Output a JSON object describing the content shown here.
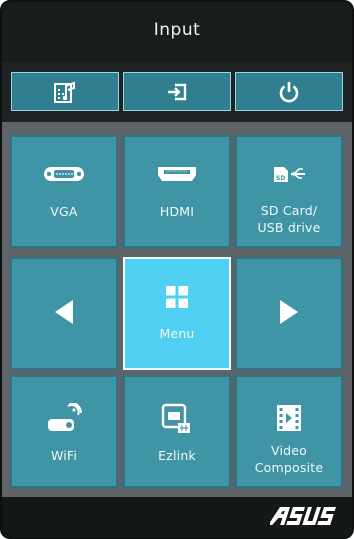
{
  "header": {
    "title": "Input"
  },
  "toolbar": {
    "buttons": [
      {
        "icon": "music-note-settings-icon"
      },
      {
        "icon": "input-source-icon"
      },
      {
        "icon": "power-icon"
      }
    ]
  },
  "tiles": {
    "vga": {
      "label": "VGA",
      "icon": "vga-port-icon"
    },
    "hdmi": {
      "label": "HDMI",
      "icon": "hdmi-port-icon"
    },
    "sd": {
      "label": "SD Card/\nUSB drive",
      "icon": "sd-usb-icon"
    },
    "left": {
      "icon": "left-arrow-icon"
    },
    "menu": {
      "label": "Menu",
      "icon": "menu-grid-icon"
    },
    "right": {
      "icon": "right-arrow-icon"
    },
    "wifi": {
      "label": "WiFi",
      "icon": "wifi-projector-icon"
    },
    "ezlink": {
      "label": "Ezlink",
      "icon": "ezlink-usb-icon"
    },
    "video": {
      "label": "Video\nComposite",
      "icon": "film-icon"
    }
  },
  "footer": {
    "brand": "ASUS"
  },
  "colors": {
    "tile": "#3f95a6",
    "tile_active": "#4fd0f2",
    "toolbar_button": "#2f7f90",
    "background": "#1b1f20"
  }
}
